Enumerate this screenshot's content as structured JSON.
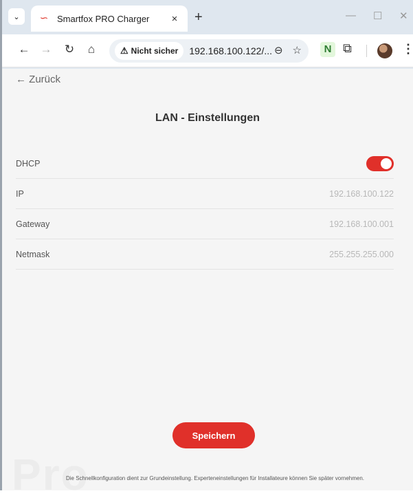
{
  "browser": {
    "tab_title": "Smartfox PRO Charger",
    "tab_close": "×",
    "new_tab": "+",
    "security_label": "Nicht sicher",
    "url": "192.168.100.122/...",
    "ext_letter": "N"
  },
  "page": {
    "back_label": "← Zurück",
    "title": "LAN - Einstellungen",
    "settings": [
      {
        "label": "DHCP",
        "type": "toggle",
        "on": true
      },
      {
        "label": "IP",
        "value": "192.168.100.122"
      },
      {
        "label": "Gateway",
        "value": "192.168.100.001"
      },
      {
        "label": "Netmask",
        "value": "255.255.255.000"
      }
    ],
    "save_label": "Speichern",
    "watermark": "Pro",
    "footer_note": "Die Schnellkonfiguration dient zur Grundeinstellung. Experteneinstellungen für Installateure können Sie später vornehmen."
  },
  "colors": {
    "accent": "#e0302a",
    "page_bg": "#f5f5f5"
  }
}
